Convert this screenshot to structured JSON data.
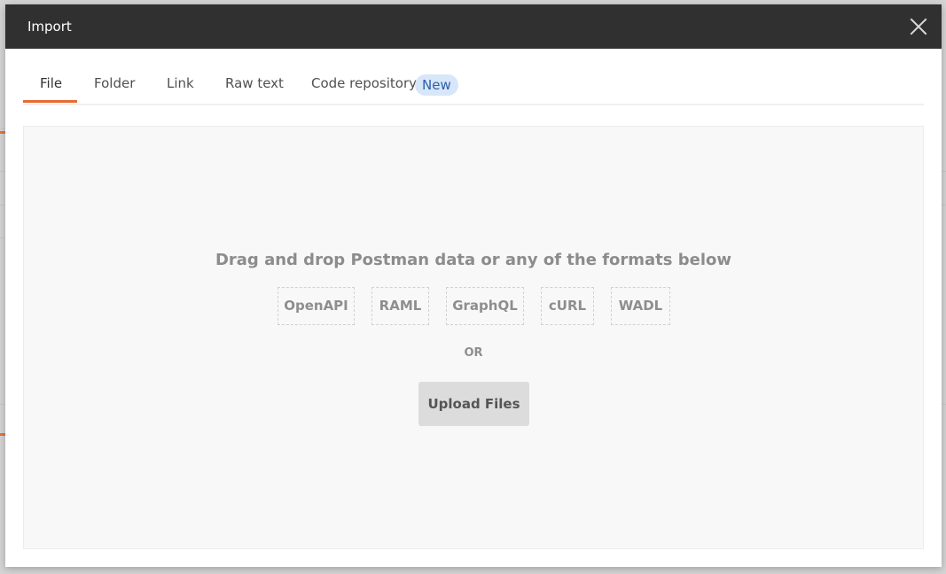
{
  "modal": {
    "title": "Import",
    "close_icon": "close-icon"
  },
  "tabs": [
    {
      "label": "File",
      "active": true
    },
    {
      "label": "Folder",
      "active": false
    },
    {
      "label": "Link",
      "active": false
    },
    {
      "label": "Raw text",
      "active": false
    },
    {
      "label": "Code repository",
      "active": false,
      "badge": "New"
    }
  ],
  "dropzone": {
    "title": "Drag and drop Postman data or any of the formats below",
    "formats": [
      "OpenAPI",
      "RAML",
      "GraphQL",
      "cURL",
      "WADL"
    ],
    "or_label": "OR",
    "upload_label": "Upload Files"
  },
  "colors": {
    "header_bg": "#303030",
    "accent": "#e56b34",
    "badge_bg": "#d8e6f9",
    "badge_text": "#2b5fae"
  }
}
